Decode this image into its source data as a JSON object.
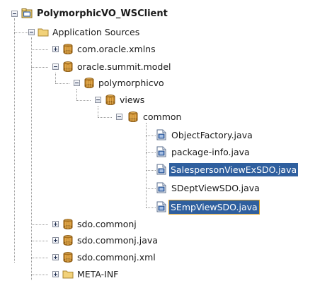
{
  "tree": {
    "nodes": [
      {
        "id": "n0",
        "label": "PolymorphicVO_WSClient",
        "icon": "project-icon",
        "expanded": true,
        "bold": true
      },
      {
        "id": "n1",
        "label": "Application Sources",
        "icon": "folder-icon",
        "expanded": true
      },
      {
        "id": "n2",
        "label": "com.oracle.xmlns",
        "icon": "package-icon",
        "expanded": false
      },
      {
        "id": "n3",
        "label": "oracle.summit.model",
        "icon": "package-icon",
        "expanded": true
      },
      {
        "id": "n4",
        "label": "polymorphicvo",
        "icon": "package-icon",
        "expanded": true
      },
      {
        "id": "n5",
        "label": "views",
        "icon": "package-icon",
        "expanded": true
      },
      {
        "id": "n6",
        "label": "common",
        "icon": "package-icon",
        "expanded": true
      },
      {
        "id": "n7",
        "label": "ObjectFactory.java",
        "icon": "java-file-icon"
      },
      {
        "id": "n8",
        "label": "package-info.java",
        "icon": "java-file-icon"
      },
      {
        "id": "n9",
        "label": "SalespersonViewExSDO.java",
        "icon": "java-file-icon",
        "selected": true
      },
      {
        "id": "n10",
        "label": "SDeptViewSDO.java",
        "icon": "java-file-icon"
      },
      {
        "id": "n11",
        "label": "SEmpViewSDO.java",
        "icon": "java-file-icon",
        "selected": true,
        "focused": true
      },
      {
        "id": "n12",
        "label": "sdo.commonj",
        "icon": "package-icon",
        "expanded": false
      },
      {
        "id": "n13",
        "label": "sdo.commonj.java",
        "icon": "package-icon",
        "expanded": false
      },
      {
        "id": "n14",
        "label": "sdo.commonj.xml",
        "icon": "package-icon",
        "expanded": false
      },
      {
        "id": "n15",
        "label": "META-INF",
        "icon": "folder-icon",
        "expanded": false
      }
    ]
  },
  "colors": {
    "selection": "#2f5f9e",
    "focus_outline": "#e0a52a",
    "package": "#c8882a",
    "folder": "#f2d27a"
  }
}
